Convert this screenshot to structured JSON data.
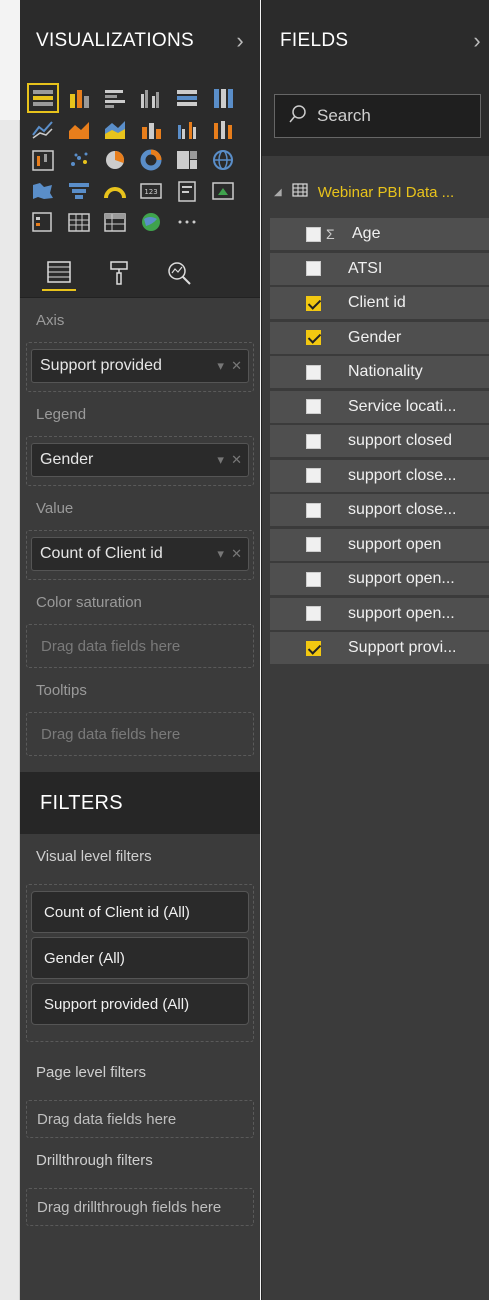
{
  "visualizations": {
    "title": "VISUALIZATIONS",
    "collapse_glyph": "›",
    "wells": {
      "axis": {
        "label": "Axis",
        "field": "Support provided"
      },
      "legend": {
        "label": "Legend",
        "field": "Gender"
      },
      "value": {
        "label": "Value",
        "field": "Count of Client id"
      },
      "color_saturation": {
        "label": "Color saturation",
        "placeholder": "Drag data fields here"
      },
      "tooltips": {
        "label": "Tooltips",
        "placeholder": "Drag data fields here"
      }
    }
  },
  "filters": {
    "title": "FILTERS",
    "visual_level": {
      "label": "Visual level filters",
      "items": [
        "Count of Client id  (All)",
        "Gender  (All)",
        "Support provided  (All)"
      ]
    },
    "page_level": {
      "label": "Page level filters",
      "placeholder": "Drag data fields here"
    },
    "drillthrough": {
      "label": "Drillthrough filters",
      "placeholder": "Drag drillthrough fields here"
    }
  },
  "fields": {
    "title": "FIELDS",
    "collapse_glyph": "›",
    "search_placeholder": "Search",
    "table_name": "Webinar PBI Data ...",
    "items": [
      {
        "label": "Age",
        "checked": false,
        "sigma": "Σ"
      },
      {
        "label": "ATSI",
        "checked": false
      },
      {
        "label": "Client id",
        "checked": true
      },
      {
        "label": "Gender",
        "checked": true
      },
      {
        "label": "Nationality",
        "checked": false
      },
      {
        "label": "Service locati...",
        "checked": false
      },
      {
        "label": "support closed",
        "checked": false
      },
      {
        "label": "support close...",
        "checked": false
      },
      {
        "label": "support close...",
        "checked": false
      },
      {
        "label": "support open",
        "checked": false
      },
      {
        "label": "support open...",
        "checked": false
      },
      {
        "label": "support open...",
        "checked": false
      },
      {
        "label": "Support provi...",
        "checked": true
      }
    ]
  },
  "colors": {
    "accent": "#f2c811",
    "pane_bg": "#3b3b3b",
    "header_bg": "#2b2b2b"
  }
}
